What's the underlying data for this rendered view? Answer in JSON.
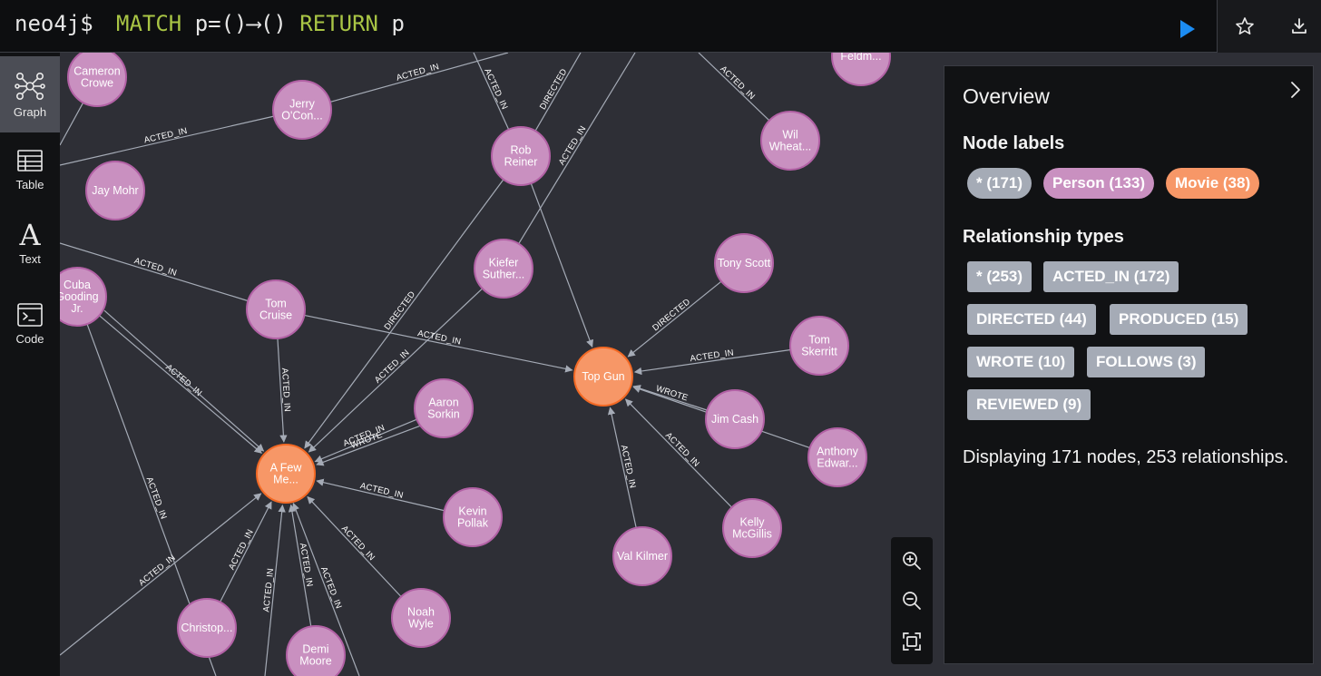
{
  "editor": {
    "prompt": "neo4j$",
    "query_match": "MATCH",
    "query_pattern": " p=()⟶() ",
    "query_return": "RETURN",
    "query_var": " p"
  },
  "nav": [
    {
      "label": "Graph",
      "icon": "graph-icon"
    },
    {
      "label": "Table",
      "icon": "table-icon"
    },
    {
      "label": "Text",
      "icon": "text-icon",
      "glyph": "A"
    },
    {
      "label": "Code",
      "icon": "code-icon"
    }
  ],
  "colors": {
    "person": "#c990c0",
    "person_border": "#b261a5",
    "movie": "#f79767",
    "movie_border": "#f36924",
    "edge": "#a5abb6",
    "all_chip": "#a5abb6",
    "run": "#1c8cf2"
  },
  "graph": {
    "nodes": [
      {
        "id": "cameron",
        "label": [
          "Cameron",
          "Crowe"
        ],
        "type": "person"
      },
      {
        "id": "jerry",
        "label": [
          "Jerry",
          "O'Con..."
        ],
        "type": "person"
      },
      {
        "id": "feldm",
        "label": [
          "Feldm..."
        ],
        "type": "person"
      },
      {
        "id": "rob",
        "label": [
          "Rob",
          "Reiner"
        ],
        "type": "person"
      },
      {
        "id": "wil",
        "label": [
          "Wil",
          "Wheat..."
        ],
        "type": "person"
      },
      {
        "id": "jaymohr",
        "label": [
          "Jay Mohr"
        ],
        "type": "person"
      },
      {
        "id": "kiefer",
        "label": [
          "Kiefer",
          "Suther..."
        ],
        "type": "person"
      },
      {
        "id": "tomscott",
        "label": [
          "Tony Scott"
        ],
        "type": "person"
      },
      {
        "id": "cuba",
        "label": [
          "Cuba",
          "Gooding",
          "Jr."
        ],
        "type": "person"
      },
      {
        "id": "tomcruise",
        "label": [
          "Tom",
          "Cruise"
        ],
        "type": "person"
      },
      {
        "id": "tomsk",
        "label": [
          "Tom",
          "Skerritt"
        ],
        "type": "person"
      },
      {
        "id": "topgun",
        "label": [
          "Top Gun"
        ],
        "type": "movie"
      },
      {
        "id": "aaron",
        "label": [
          "Aaron",
          "Sorkin"
        ],
        "type": "person"
      },
      {
        "id": "jimcash",
        "label": [
          "Jim Cash"
        ],
        "type": "person"
      },
      {
        "id": "anthony",
        "label": [
          "Anthony",
          "Edwar..."
        ],
        "type": "person"
      },
      {
        "id": "afew",
        "label": [
          "A Few",
          "Me..."
        ],
        "type": "movie"
      },
      {
        "id": "kevin",
        "label": [
          "Kevin",
          "Pollak"
        ],
        "type": "person"
      },
      {
        "id": "kelly",
        "label": [
          "Kelly",
          "McGillis"
        ],
        "type": "person"
      },
      {
        "id": "valkilmer",
        "label": [
          "Val Kilmer"
        ],
        "type": "person"
      },
      {
        "id": "noah",
        "label": [
          "Noah",
          "Wyle"
        ],
        "type": "person"
      },
      {
        "id": "christop",
        "label": [
          "Christop..."
        ],
        "type": "person"
      },
      {
        "id": "demi",
        "label": [
          "Demi",
          "Moore"
        ],
        "type": "person"
      }
    ],
    "relationships": [
      {
        "from": "jerry",
        "to": "off-top",
        "label": "ACTED_IN"
      },
      {
        "from": "cameron",
        "to": "off-left",
        "label": ""
      },
      {
        "from": "jerry",
        "to": "off-left",
        "label": "ACTED_IN"
      },
      {
        "from": "wil",
        "to": "off-top",
        "label": "ACTED_IN"
      },
      {
        "from": "rob",
        "to": "off-top",
        "label": "ACTED_IN"
      },
      {
        "from": "rob",
        "to": "off-top",
        "label": "DIRECTED"
      },
      {
        "from": "tomcruise",
        "to": "off-left",
        "label": "ACTED_IN"
      },
      {
        "from": "kiefer",
        "to": "off-top",
        "label": "ACTED_IN"
      },
      {
        "from": "rob",
        "to": "afew",
        "label": "DIRECTED"
      },
      {
        "from": "rob",
        "to": "topgun",
        "label": ""
      },
      {
        "from": "kiefer",
        "to": "afew",
        "label": "ACTED_IN"
      },
      {
        "from": "tomscott",
        "to": "topgun",
        "label": "DIRECTED"
      },
      {
        "from": "tomsk",
        "to": "topgun",
        "label": "ACTED_IN"
      },
      {
        "from": "tomcruise",
        "to": "topgun",
        "label": "ACTED_IN"
      },
      {
        "from": "tomcruise",
        "to": "afew",
        "label": "ACTED_IN"
      },
      {
        "from": "cuba",
        "to": "afew",
        "label": "ACTED_IN"
      },
      {
        "from": "cuba",
        "to": "afew",
        "label": ""
      },
      {
        "from": "cuba",
        "to": "off-bottom",
        "label": "ACTED_IN"
      },
      {
        "from": "aaron",
        "to": "afew",
        "label": "ACTED_IN"
      },
      {
        "from": "aaron",
        "to": "afew",
        "label": "WROTE"
      },
      {
        "from": "jimcash",
        "to": "topgun",
        "label": "WROTE"
      },
      {
        "from": "anthony",
        "to": "topgun",
        "label": ""
      },
      {
        "from": "kelly",
        "to": "topgun",
        "label": "ACTED_IN"
      },
      {
        "from": "valkilmer",
        "to": "topgun",
        "label": "ACTED_IN"
      },
      {
        "from": "kevin",
        "to": "afew",
        "label": "ACTED_IN"
      },
      {
        "from": "noah",
        "to": "afew",
        "label": "ACTED_IN"
      },
      {
        "from": "christop",
        "to": "afew",
        "label": "ACTED_IN"
      },
      {
        "from": "demi",
        "to": "afew",
        "label": "ACTED_IN"
      },
      {
        "from": "off-bottom",
        "to": "afew",
        "label": "ACTED_IN"
      },
      {
        "from": "off-bottom",
        "to": "afew",
        "label": "ACTED_IN"
      },
      {
        "from": "off-left",
        "to": "afew",
        "label": "ACTED_IN"
      }
    ]
  },
  "zoom": [
    {
      "name": "zoom-in-icon"
    },
    {
      "name": "zoom-out-icon"
    },
    {
      "name": "fit-screen-icon"
    }
  ],
  "overview": {
    "title": "Overview",
    "node_labels_heading": "Node labels",
    "node_labels": [
      {
        "text": "* (171)",
        "kind": "all"
      },
      {
        "text": "Person (133)",
        "kind": "person"
      },
      {
        "text": "Movie (38)",
        "kind": "movie"
      }
    ],
    "rel_types_heading": "Relationship types",
    "rel_types": [
      "* (253)",
      "ACTED_IN (172)",
      "DIRECTED (44)",
      "PRODUCED (15)",
      "WROTE (10)",
      "FOLLOWS (3)",
      "REVIEWED (9)"
    ],
    "summary": "Displaying 171 nodes, 253 relationships."
  }
}
